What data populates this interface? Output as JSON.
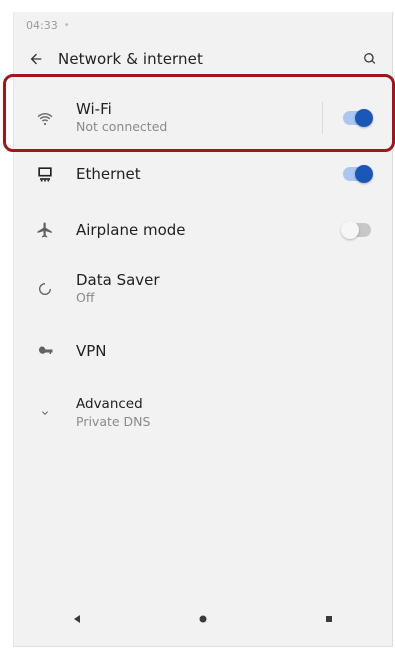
{
  "status_bar": {
    "time": "04:33"
  },
  "top_bar": {
    "title": "Network & internet",
    "back_icon": "arrow-left-icon",
    "search_icon": "search-icon"
  },
  "items": [
    {
      "key": "wifi",
      "icon": "wifi-icon",
      "title": "Wi-Fi",
      "subtitle": "Not connected",
      "toggle": "on"
    },
    {
      "key": "ethernet",
      "icon": "ethernet-icon",
      "title": "Ethernet",
      "subtitle": "",
      "toggle": "on"
    },
    {
      "key": "airplane",
      "icon": "airplane-icon",
      "title": "Airplane mode",
      "subtitle": "",
      "toggle": "off"
    },
    {
      "key": "data_saver",
      "icon": "data-saver-icon",
      "title": "Data Saver",
      "subtitle": "Off",
      "toggle": ""
    },
    {
      "key": "vpn",
      "icon": "vpn-key-icon",
      "title": "VPN",
      "subtitle": "",
      "toggle": ""
    },
    {
      "key": "advanced",
      "icon": "chevron-down-icon",
      "title": "Advanced",
      "subtitle": "Private DNS",
      "toggle": ""
    }
  ],
  "navigation": {
    "back": "nav-back-icon",
    "home": "nav-home-icon",
    "recents": "nav-recents-icon"
  },
  "colors": {
    "highlight": "#a1161a",
    "toggle_on": "#1a57b6"
  }
}
